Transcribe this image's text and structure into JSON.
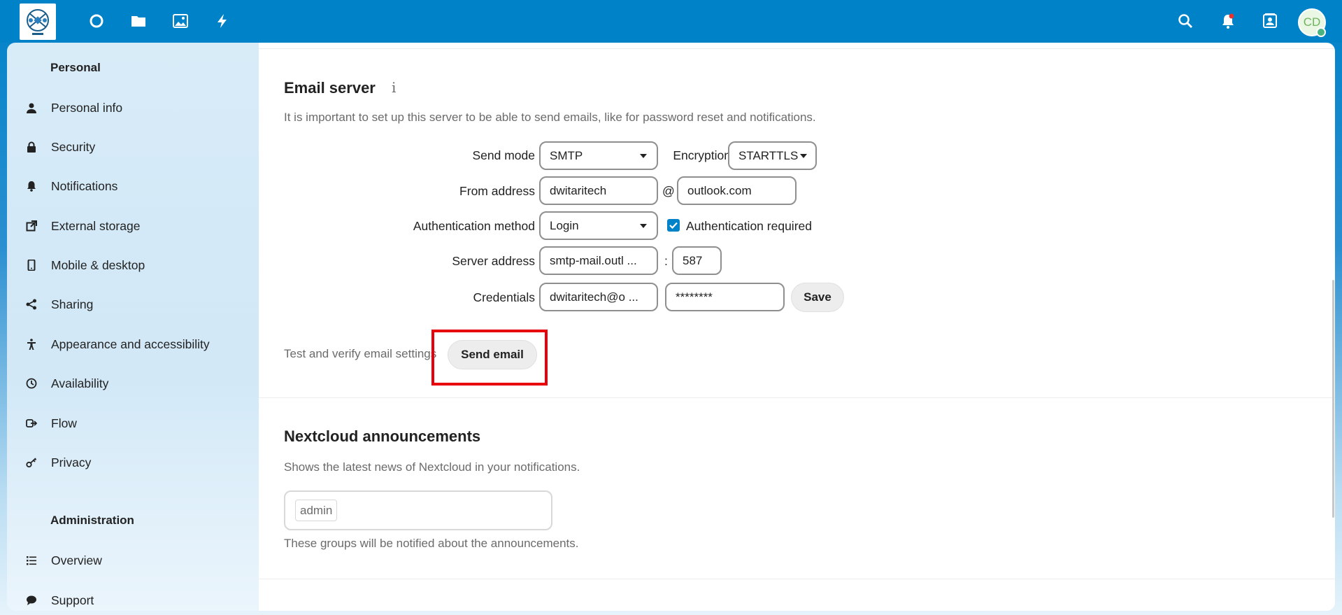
{
  "header": {
    "logo_name": "app-logo",
    "nav_icons": [
      "dashboard-icon",
      "files-icon",
      "photos-icon",
      "activity-icon"
    ],
    "right_icons": [
      "search-icon",
      "notifications-icon",
      "contacts-icon"
    ],
    "avatar_initials": "CD"
  },
  "sidebar": {
    "personal_heading": "Personal",
    "personal_items": [
      {
        "label": "Personal info",
        "icon": "user-icon"
      },
      {
        "label": "Security",
        "icon": "lock-icon"
      },
      {
        "label": "Notifications",
        "icon": "bell-icon"
      },
      {
        "label": "External storage",
        "icon": "external-link-icon"
      },
      {
        "label": "Mobile & desktop",
        "icon": "phone-icon"
      },
      {
        "label": "Sharing",
        "icon": "share-icon"
      },
      {
        "label": "Appearance and accessibility",
        "icon": "accessibility-icon"
      },
      {
        "label": "Availability",
        "icon": "clock-icon"
      },
      {
        "label": "Flow",
        "icon": "flow-icon"
      },
      {
        "label": "Privacy",
        "icon": "key-icon"
      }
    ],
    "admin_heading": "Administration",
    "admin_items": [
      {
        "label": "Overview",
        "icon": "list-icon"
      },
      {
        "label": "Support",
        "icon": "chat-icon"
      }
    ]
  },
  "email_server": {
    "title": "Email server",
    "info_glyph": "i",
    "description": "It is important to set up this server to be able to send emails, like for password reset and notifications.",
    "send_mode_label": "Send mode",
    "send_mode_value": "SMTP",
    "encryption_label": "Encryption",
    "encryption_value": "STARTTLS",
    "from_address_label": "From address",
    "from_user": "dwitaritech",
    "at_sign": "@",
    "from_domain": "outlook.com",
    "auth_method_label": "Authentication method",
    "auth_method_value": "Login",
    "auth_required_label": "Authentication required",
    "auth_required_checked": true,
    "server_address_label": "Server address",
    "server_host": "smtp-mail.outl  ...",
    "port_sep": ":",
    "server_port": "587",
    "credentials_label": "Credentials",
    "cred_user": "dwitaritech@o  ...",
    "cred_password": "********",
    "save_label": "Save",
    "test_label": "Test and verify email settings",
    "send_email_label": "Send email"
  },
  "announcements": {
    "title": "Nextcloud announcements",
    "description": "Shows the latest news of Nextcloud in your notifications.",
    "group_chip": "admin",
    "note": "These groups will be notified about the announcements."
  },
  "colors": {
    "brand": "#0082c9",
    "highlight": "#e8000b",
    "status_online": "#49b382"
  }
}
